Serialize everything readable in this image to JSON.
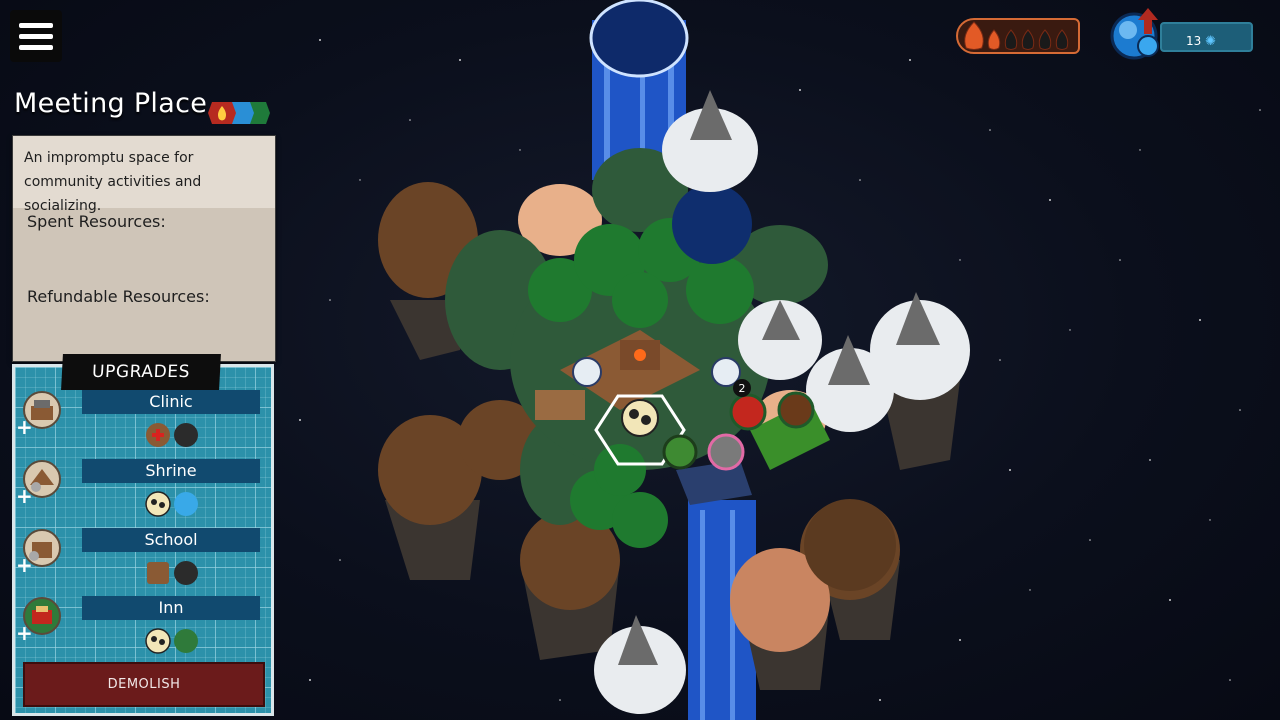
{
  "menu": {
    "icon": "hamburger-menu-icon"
  },
  "building": {
    "title": "Meeting Place",
    "element_icons": [
      "fire-element-icon",
      "water-element-icon",
      "nature-element-icon"
    ],
    "description": "An impromptu space for community activities and socializing.",
    "spent_label": "Spent Resources:",
    "refundable_label": "Refundable Resources:"
  },
  "upgrades": {
    "header": "UPGRADES",
    "items": [
      {
        "name": "Clinic",
        "icon": "clinic-building-icon",
        "resources": [
          "medicine-icon",
          "stone-icon"
        ]
      },
      {
        "name": "Shrine",
        "icon": "shrine-building-icon",
        "resources": [
          "theater-masks-icon",
          "water-icon"
        ]
      },
      {
        "name": "School",
        "icon": "school-building-icon",
        "resources": [
          "wood-icon",
          "stone-icon"
        ]
      },
      {
        "name": "Inn",
        "icon": "inn-building-icon",
        "resources": [
          "theater-masks-icon",
          "food-icon"
        ]
      }
    ],
    "demolish_label": "DEMOLISH"
  },
  "hud": {
    "fire": {
      "icon": "fire-icon",
      "filled": 2,
      "total": 6
    },
    "water": {
      "icon": "water-orb-icon",
      "count": "13",
      "trend": "up"
    }
  },
  "map": {
    "markers": [
      {
        "icon": "community-masks-icon",
        "label": ""
      },
      {
        "icon": "food-tomato-icon",
        "label": ""
      },
      {
        "icon": "villager-icon",
        "label": "2"
      }
    ]
  },
  "colors": {
    "panel_parchment": "#cfc5b8",
    "grid_blue": "#2c91aa",
    "upgrade_name_bar": "#114a6f",
    "demolish_red": "#6b1b1b",
    "fire_orange": "#e25a26",
    "water_blue": "#2a8fd6"
  }
}
